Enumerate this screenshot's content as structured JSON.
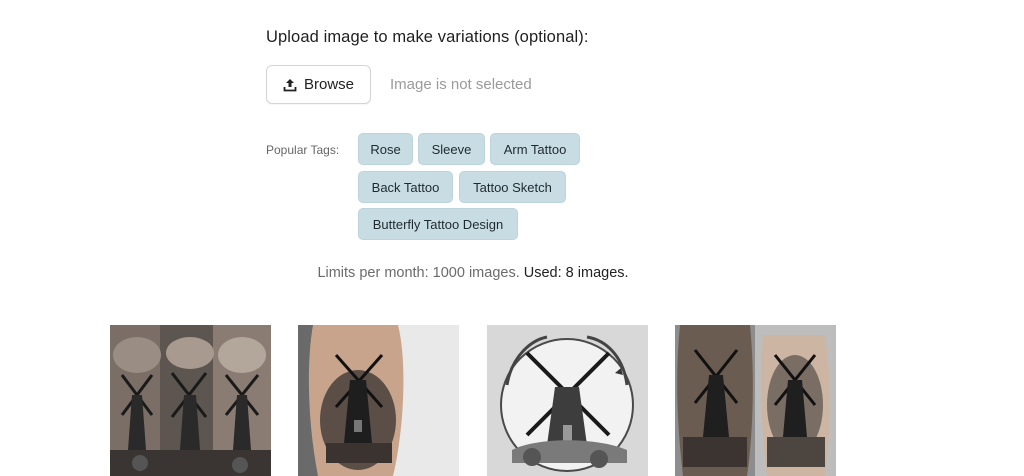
{
  "upload": {
    "heading": "Upload image to make variations (optional):",
    "browse_label": "Browse",
    "browse_icon": "upload-icon",
    "status": "Image is not selected"
  },
  "tags": {
    "label": "Popular Tags:",
    "items": [
      "Rose",
      "Sleeve",
      "Arm Tattoo",
      "Back Tattoo",
      "Tattoo Sketch",
      "Butterfly Tattoo Design"
    ]
  },
  "limits": {
    "text": "Limits per month: 1000 images.",
    "used": "Used: 8 images."
  },
  "gallery": {
    "items": [
      {
        "alt": "windmill sleeve tattoo variation 1"
      },
      {
        "alt": "windmill sleeve tattoo variation 2"
      },
      {
        "alt": "windmill tattoo sketch variation 3"
      },
      {
        "alt": "windmill sleeve tattoo variation 4"
      }
    ]
  },
  "colors": {
    "tag_bg": "#c8dde3",
    "muted_text": "#9a9a9a"
  }
}
